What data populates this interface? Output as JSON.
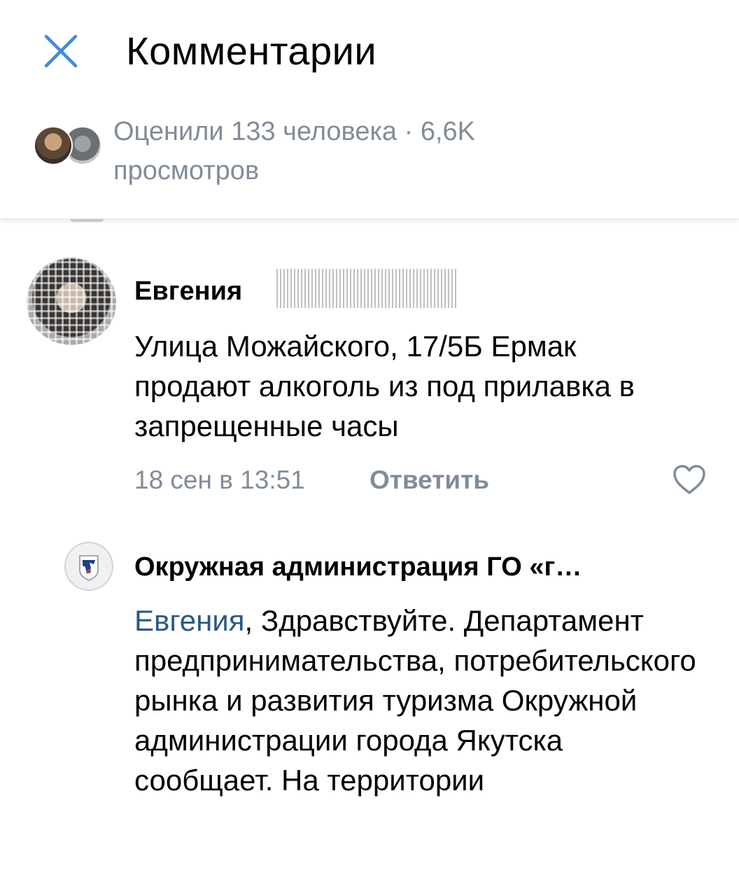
{
  "header": {
    "title": "Комментарии",
    "likes_text": "Оценили 133 человека · 6,6K просмотров"
  },
  "comments": [
    {
      "author": "Евгения",
      "text": "Улица Можайского, 17/5Б Ермак продают алкоголь из под прилавка в запрещенные часы",
      "time": "18 сен в 13:51",
      "reply_label": "Ответить"
    },
    {
      "author": "Окружная администрация ГО «г…",
      "mention": "Евгения",
      "text": ", Здравствуйте. Департамент предпринимательства, потребительского рынка и развития туризма Окружной администрации города Якутска сообщает. На территории"
    }
  ],
  "colors": {
    "accent": "#3f8ae0",
    "secondary_text": "#818c99",
    "link": "#2a5885"
  },
  "icons": {
    "close": "close-icon",
    "like": "heart-icon"
  }
}
